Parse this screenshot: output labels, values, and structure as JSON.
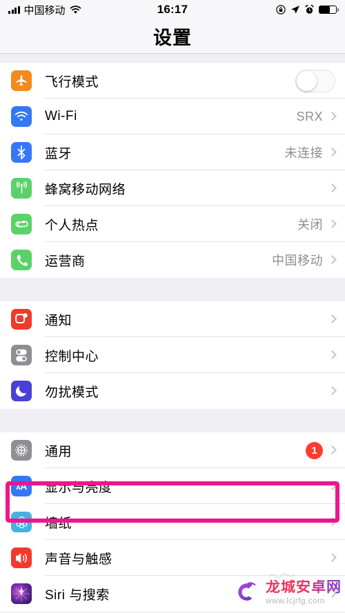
{
  "status_bar": {
    "carrier": "中国移动",
    "signal_icon": "signal-bars-icon",
    "wifi_icon": "wifi-icon",
    "time": "16:17",
    "rotation_lock_icon": "rotation-lock-icon",
    "location_icon": "location-arrow-icon",
    "alarm_icon": "alarm-clock-icon",
    "battery_icon": "battery-icon",
    "battery_level_pct": 62
  },
  "navbar": {
    "title": "设置"
  },
  "colors": {
    "page_background": "#efeff4",
    "row_background": "#ffffff",
    "value_text": "#8e8e93",
    "badge": "#ff3b30",
    "highlight": "#ed1691",
    "orange": "#f4891d",
    "blue": "#3578f6",
    "green": "#5bd16a",
    "red": "#f3382c",
    "gray": "#8e8e93",
    "indigo": "#4a40d8",
    "light_blue": "#45b3e0"
  },
  "groups": [
    {
      "name": "connectivity",
      "rows": [
        {
          "label": "飞行模式",
          "icon": "airplane-icon",
          "icon_class": "ic-plane",
          "accessory": "toggle",
          "toggle_on": false
        },
        {
          "label": "Wi-Fi",
          "icon": "wifi-icon",
          "icon_class": "ic-wifi",
          "accessory": "value",
          "value": "SRX"
        },
        {
          "label": "蓝牙",
          "icon": "bluetooth-icon",
          "icon_class": "ic-bt",
          "accessory": "value",
          "value": "未连接"
        },
        {
          "label": "蜂窝移动网络",
          "icon": "cellular-icon",
          "icon_class": "ic-cell",
          "accessory": "chevron",
          "value": ""
        },
        {
          "label": "个人热点",
          "icon": "hotspot-icon",
          "icon_class": "ic-hotspot",
          "accessory": "value",
          "value": "关闭"
        },
        {
          "label": "运营商",
          "icon": "phone-icon",
          "icon_class": "ic-carrier",
          "accessory": "value",
          "value": "中国移动"
        }
      ]
    },
    {
      "name": "alerts",
      "rows": [
        {
          "label": "通知",
          "icon": "notifications-icon",
          "icon_class": "ic-notif",
          "accessory": "chevron",
          "value": ""
        },
        {
          "label": "控制中心",
          "icon": "control-center-icon",
          "icon_class": "ic-cc",
          "accessory": "chevron",
          "value": ""
        },
        {
          "label": "勿扰模式",
          "icon": "do-not-disturb-moon-icon",
          "icon_class": "ic-dnd",
          "accessory": "chevron",
          "value": ""
        }
      ]
    },
    {
      "name": "system",
      "rows": [
        {
          "label": "通用",
          "icon": "gear-icon",
          "icon_class": "ic-general",
          "accessory": "badge",
          "badge": "1"
        },
        {
          "label": "显示与亮度",
          "icon": "display-brightness-icon",
          "icon_class": "ic-display",
          "accessory": "chevron",
          "value": "",
          "highlighted": true
        },
        {
          "label": "墙纸",
          "icon": "wallpaper-flower-icon",
          "icon_class": "ic-wall",
          "accessory": "chevron",
          "value": ""
        },
        {
          "label": "声音与触感",
          "icon": "speaker-icon",
          "icon_class": "ic-sound",
          "accessory": "chevron",
          "value": ""
        },
        {
          "label": "Siri 与搜索",
          "icon": "siri-icon",
          "icon_class": "ic-siri",
          "accessory": "chevron",
          "value": ""
        }
      ]
    }
  ],
  "watermark": {
    "title": "龙城安卓网",
    "url": "www.lcjrfg.com",
    "logo_icon": "dragon-logo-icon"
  }
}
